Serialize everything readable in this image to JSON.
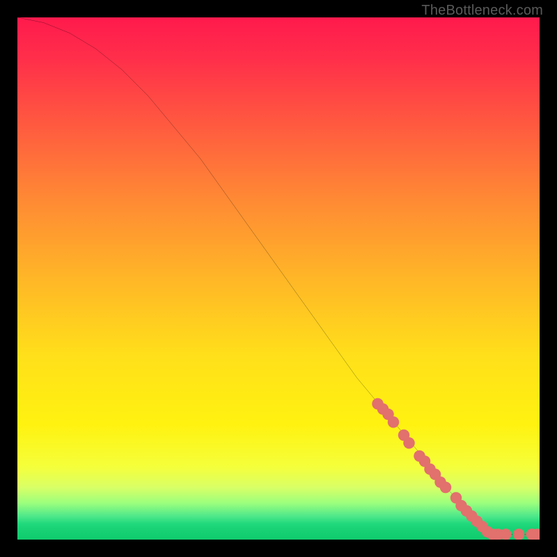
{
  "watermark": "TheBottleneck.com",
  "chart_data": {
    "type": "line",
    "title": "",
    "xlabel": "",
    "ylabel": "",
    "xlim": [
      0,
      100
    ],
    "ylim": [
      0,
      100
    ],
    "grid": false,
    "series": [
      {
        "name": "bottleneck-curve",
        "x": [
          0,
          5,
          10,
          15,
          20,
          25,
          30,
          35,
          40,
          45,
          50,
          55,
          60,
          65,
          70,
          75,
          80,
          82,
          84,
          86,
          88,
          90,
          92,
          94,
          96,
          98,
          100
        ],
        "y": [
          100,
          99,
          97,
          94,
          90,
          85,
          79,
          73,
          66,
          59,
          52,
          45,
          38,
          31,
          25,
          19,
          13,
          10,
          8,
          6,
          4,
          2,
          1,
          1,
          1,
          1,
          1
        ]
      }
    ],
    "markers": {
      "name": "highlighted-points",
      "color": "#e2706d",
      "points": [
        {
          "x": 69,
          "y": 26
        },
        {
          "x": 70,
          "y": 25
        },
        {
          "x": 71,
          "y": 24
        },
        {
          "x": 72,
          "y": 22.5
        },
        {
          "x": 74,
          "y": 20
        },
        {
          "x": 75,
          "y": 18.5
        },
        {
          "x": 77,
          "y": 16
        },
        {
          "x": 78,
          "y": 15
        },
        {
          "x": 79,
          "y": 13.5
        },
        {
          "x": 80,
          "y": 12.5
        },
        {
          "x": 81,
          "y": 11
        },
        {
          "x": 82,
          "y": 10
        },
        {
          "x": 84,
          "y": 8
        },
        {
          "x": 85,
          "y": 6.5
        },
        {
          "x": 86,
          "y": 5.5
        },
        {
          "x": 87,
          "y": 4.5
        },
        {
          "x": 88,
          "y": 3.5
        },
        {
          "x": 89,
          "y": 2.5
        },
        {
          "x": 90,
          "y": 1.5
        },
        {
          "x": 91,
          "y": 1
        },
        {
          "x": 92,
          "y": 1
        },
        {
          "x": 93.5,
          "y": 1
        },
        {
          "x": 96,
          "y": 1
        },
        {
          "x": 98.5,
          "y": 1
        },
        {
          "x": 99.5,
          "y": 1
        }
      ]
    },
    "background_gradient_stops": [
      {
        "pos": 0,
        "color": "#ff1a4d"
      },
      {
        "pos": 0.35,
        "color": "#ff8a34"
      },
      {
        "pos": 0.65,
        "color": "#ffe01a"
      },
      {
        "pos": 0.9,
        "color": "#d9ff66"
      },
      {
        "pos": 1.0,
        "color": "#10cc6e"
      }
    ]
  }
}
